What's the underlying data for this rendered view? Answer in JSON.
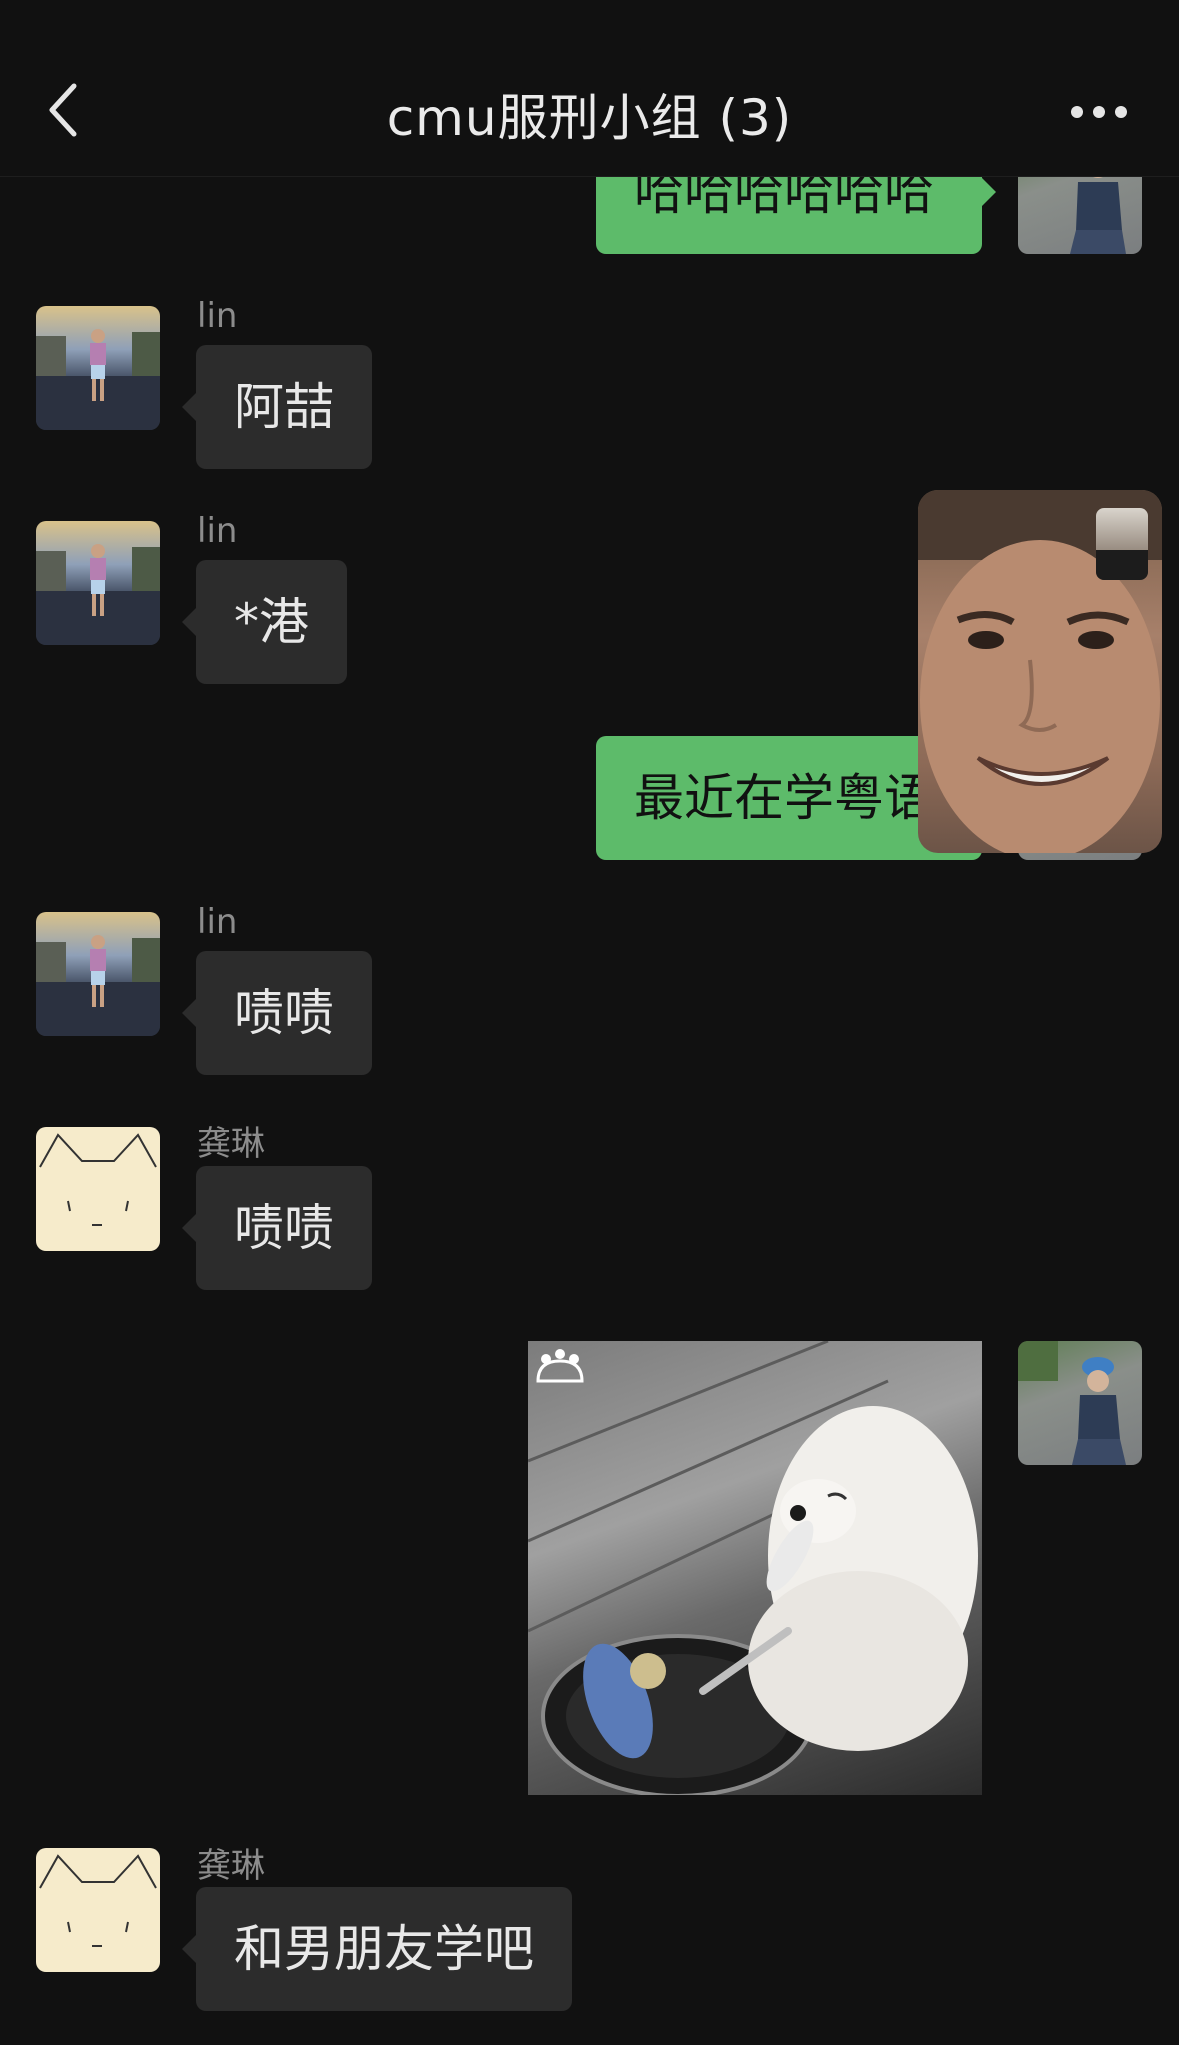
{
  "header": {
    "title": "cmu服刑小组 (3)",
    "back_icon": "chevron-left-icon",
    "more_icon": "more-horizontal-icon"
  },
  "messages": [
    {
      "from": "me",
      "text": "哈哈哈哈哈哈"
    },
    {
      "from": "lin",
      "sender": "lin",
      "text": "阿喆"
    },
    {
      "from": "lin",
      "sender": "lin",
      "text": "*港"
    },
    {
      "from": "me",
      "text": "最近在学粤语"
    },
    {
      "from": "lin",
      "sender": "lin",
      "text": "啧啧"
    },
    {
      "from": "gonglin",
      "sender": "龚琳",
      "text": "啧啧"
    },
    {
      "from": "me",
      "type": "image",
      "image": "puppy-frying-fish-gif"
    },
    {
      "from": "gonglin",
      "sender": "龚琳",
      "text": "和男朋友学吧"
    }
  ],
  "colors": {
    "background": "#111111",
    "incoming_bubble": "#2c2c2c",
    "outgoing_bubble": "#5dbb6a",
    "sender_name": "#8c8c8c"
  }
}
